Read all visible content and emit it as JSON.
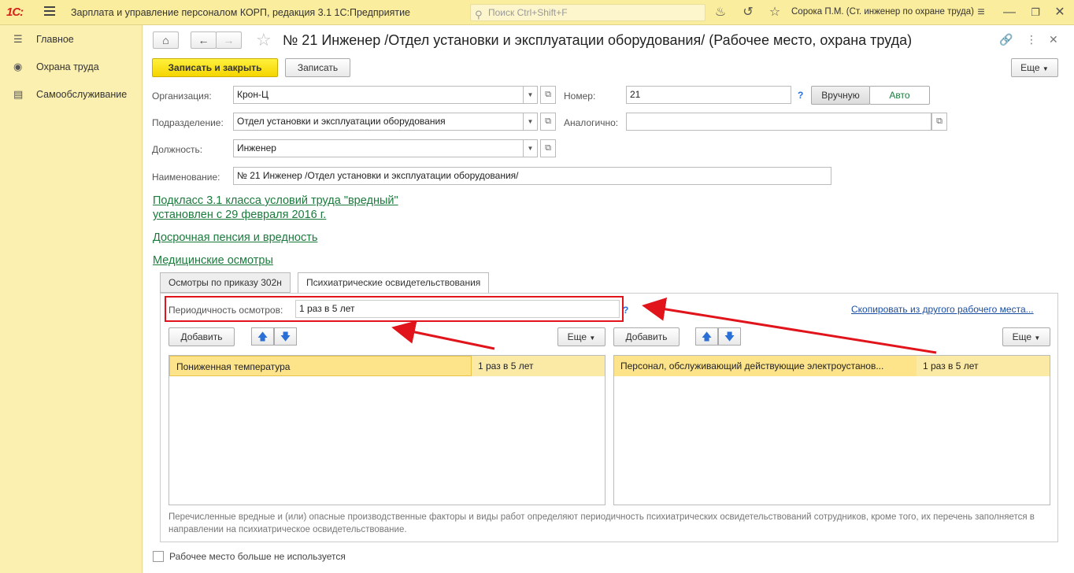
{
  "titlebar": {
    "logo": "1С:",
    "app_title": "Зарплата и управление персоналом КОРП, редакция 3.1 1С:Предприятие",
    "search_placeholder": "Поиск Ctrl+Shift+F",
    "user": "Сорока П.М. (Ст. инженер по охране труда)"
  },
  "sidebar": {
    "items": [
      {
        "label": "Главное",
        "icon": "menu-lines-icon"
      },
      {
        "label": "Охрана труда",
        "icon": "helmet-icon"
      },
      {
        "label": "Самообслуживание",
        "icon": "card-icon"
      }
    ]
  },
  "document": {
    "title": "№ 21 Инженер /Отдел установки и эксплуатации оборудования/ (Рабочее место, охрана труда)",
    "save_close": "Записать и закрыть",
    "save": "Записать",
    "more": "Еще"
  },
  "form": {
    "org_label": "Организация:",
    "org_value": "Крон-Ц",
    "number_label": "Номер:",
    "number_value": "21",
    "number_help": "?",
    "mode_manual": "Вручную",
    "mode_auto": "Авто",
    "division_label": "Подразделение:",
    "division_value": "Отдел установки и эксплуатации оборудования",
    "similar_label": "Аналогично:",
    "similar_value": "",
    "position_label": "Должность:",
    "position_value": "Инженер",
    "name_label": "Наименование:",
    "name_value": "№ 21 Инженер /Отдел установки и эксплуатации оборудования/"
  },
  "links": {
    "subclass_line1": "Подкласс 3.1 класса условий труда \"вредный\"",
    "subclass_line2": "установлен с 29 февраля 2016 г.",
    "pension": "Досрочная пенсия и вредность",
    "medical": "Медицинские осмотры"
  },
  "tabs": [
    {
      "label": "Осмотры по приказу 302н",
      "active": false
    },
    {
      "label": "Психиатрические освидетельствования",
      "active": true
    }
  ],
  "panel": {
    "periodicity_label": "Периодичность осмотров:",
    "periodicity_value": "1 раз в 5 лет",
    "help": "?",
    "copy_link": "Скопировать из другого рабочего места...",
    "add": "Добавить",
    "more": "Еще",
    "left_rows": [
      {
        "name": "Пониженная температура",
        "period": "1 раз в 5 лет"
      }
    ],
    "right_rows": [
      {
        "name": "Персонал, обслуживающий действующие электроустанов...",
        "period": "1 раз в 5 лет"
      }
    ],
    "hint": "Перечисленные вредные и (или) опасные производственные факторы и виды работ определяют периодичность психиатрических освидетельствований сотрудников, кроме того, их перечень заполняется в направлении на психиатрическое освидетельствование."
  },
  "footer": {
    "unused_label": "Рабочее место больше не используется"
  },
  "colors": {
    "accent_yellow": "#f5d500",
    "link_green": "#1c7a3d",
    "annotation_red": "#e1141b"
  }
}
